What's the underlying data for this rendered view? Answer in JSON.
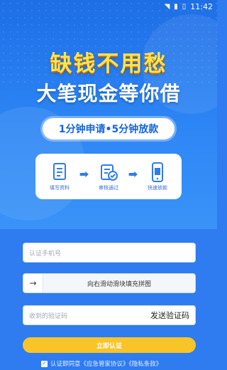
{
  "status_bar": {
    "time": "11:42"
  },
  "hero": {
    "headline": "缺钱不用愁",
    "subheadline": "大笔现金等你借",
    "pill_text": "1分钟申请•5分钟放款",
    "steps": [
      {
        "label": "填写资料",
        "icon": "form-document-icon"
      },
      {
        "label": "审核通过",
        "icon": "approval-check-icon"
      },
      {
        "label": "快速放款",
        "icon": "phone-money-icon"
      }
    ]
  },
  "form": {
    "phone_placeholder": "认证手机号",
    "slider_arrow": "→",
    "slider_text": "向右滑动滑块填充拼图",
    "code_placeholder": "收到的验证码",
    "send_code_label": "发送验证码",
    "submit_label": "立即认证",
    "agreement_text": "认证即同意《应急管家协议》《隐私条款》"
  },
  "colors": {
    "primary_blue": "#2f7bf0",
    "headline_yellow": "#ffe44a",
    "submit_yellow": "#f8c428"
  }
}
